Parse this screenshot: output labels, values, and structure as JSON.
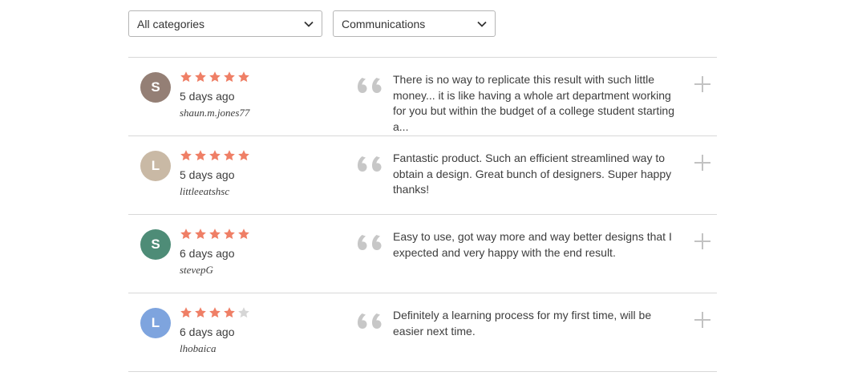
{
  "filters": {
    "category": "All categories",
    "subcategory": "Communications"
  },
  "colors": {
    "star_filled": "#ef7f66",
    "star_empty": "#d6d6d6",
    "quote": "#c7c7c7",
    "plus": "#c2c2c2"
  },
  "reviews": [
    {
      "initial": "S",
      "avatar_color": "#947f75",
      "rating": 5,
      "date": "5 days ago",
      "user": "shaun.m.jones77",
      "text": "There is no way to replicate this result with such little money... it is like having a whole art department working for you but within the budget of a college student starting a..."
    },
    {
      "initial": "L",
      "avatar_color": "#c9b9a5",
      "rating": 5,
      "date": "5 days ago",
      "user": "littleeatshsc",
      "text": "Fantastic product. Such an efficient streamlined way to obtain a design. Great bunch of designers. Super happy thanks!"
    },
    {
      "initial": "S",
      "avatar_color": "#4e8c77",
      "rating": 5,
      "date": "6 days ago",
      "user": "stevepG",
      "text": "Easy to use, got way more and way better designs that I expected and very happy with the end result."
    },
    {
      "initial": "L",
      "avatar_color": "#7ea4de",
      "rating": 4,
      "date": "6 days ago",
      "user": "lhobaica",
      "text": "Definitely a learning process for my first time, will be easier next time."
    }
  ]
}
